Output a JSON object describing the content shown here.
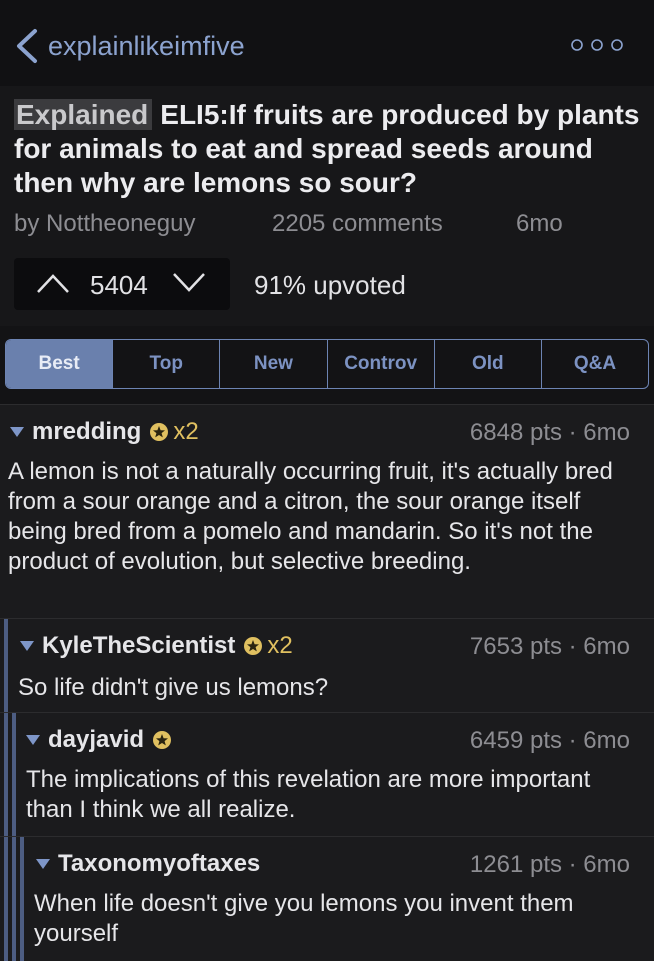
{
  "topbar": {
    "subreddit": "explainlikeimfive"
  },
  "post": {
    "flair": "Explained",
    "title": "ELI5:If fruits are produced by plants for animals to eat and spread seeds around then why are lemons so sour?",
    "author": "by Nottheoneguy",
    "comments": "2205 comments",
    "age": "6mo",
    "score": "5404",
    "upvoted": "91% upvoted"
  },
  "sort_tabs": [
    "Best",
    "Top",
    "New",
    "Controv",
    "Old",
    "Q&A"
  ],
  "comments": [
    {
      "author": "mredding",
      "gold": "x2",
      "points": "6848 pts · 6mo",
      "text": "A lemon is not a naturally occurring fruit, it's actually bred from a sour orange and a citron, the sour orange itself being bred from a pomelo and mandarin. So it's not the product of evolution, but selective breeding."
    },
    {
      "author": "KyleTheScientist",
      "gold": "x2",
      "points": "7653 pts · 6mo",
      "text": "So life didn't give us lemons?"
    },
    {
      "author": "dayjavid",
      "gold": "",
      "points": "6459 pts · 6mo",
      "text": "The implications of this revelation are more important than I think we all realize."
    },
    {
      "author": "Taxonomyoftaxes",
      "gold": "",
      "points": "1261 pts · 6mo",
      "text": "When life doesn't give you lemons you invent them yourself"
    }
  ],
  "colors": {
    "accent": "#7e96c8",
    "gold": "#e0c060",
    "background": "#1b1b1d"
  }
}
